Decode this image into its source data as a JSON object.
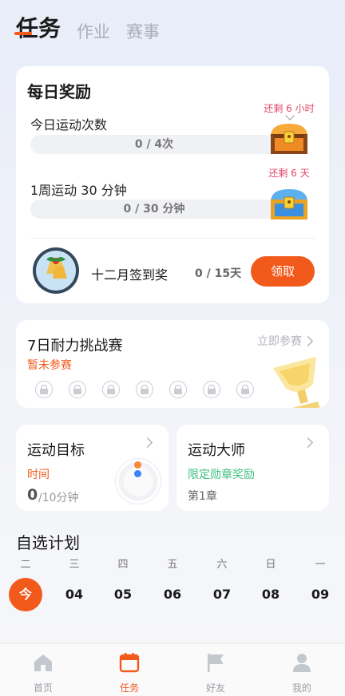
{
  "tabs": [
    {
      "label": "任务"
    },
    {
      "label": "作业"
    },
    {
      "label": "赛事"
    }
  ],
  "daily": {
    "title": "每日奖励",
    "tasks": [
      {
        "label": "今日运动次数",
        "progress_text": "0 / 4次",
        "progress_value": 0,
        "remain": "还剩 6 小时"
      },
      {
        "label": "1周运动 30 分钟",
        "progress_text": "0 / 30 分钟",
        "progress_value": 0,
        "remain": "还剩 6 天"
      }
    ],
    "signin_label": "十二月签到奖",
    "signin_count": "0 / 15天",
    "claim_label": "领取"
  },
  "challenge": {
    "title": "7日耐力挑战赛",
    "status": "暂未参赛",
    "join_label": "立即参赛",
    "locked_days": 7
  },
  "goal": {
    "title": "运动目标",
    "subtitle": "时间",
    "value": "0",
    "unit": "/10分钟"
  },
  "master": {
    "title": "运动大师",
    "subtitle": "限定勋章奖励",
    "chapter": "第1章"
  },
  "plans": {
    "title": "自选计划",
    "weekdays": [
      "二",
      "三",
      "四",
      "五",
      "六",
      "日",
      "一"
    ],
    "dates": [
      "今",
      "04",
      "05",
      "06",
      "07",
      "08",
      "09"
    ]
  },
  "nav": [
    {
      "label": "首页",
      "icon": "home-icon"
    },
    {
      "label": "任务",
      "icon": "calendar-icon"
    },
    {
      "label": "好友",
      "icon": "flag-icon"
    },
    {
      "label": "我的",
      "icon": "user-icon"
    }
  ],
  "colors": {
    "accent": "#f25a1c",
    "remain": "#e0456a",
    "reward_green": "#3fbf7f"
  }
}
